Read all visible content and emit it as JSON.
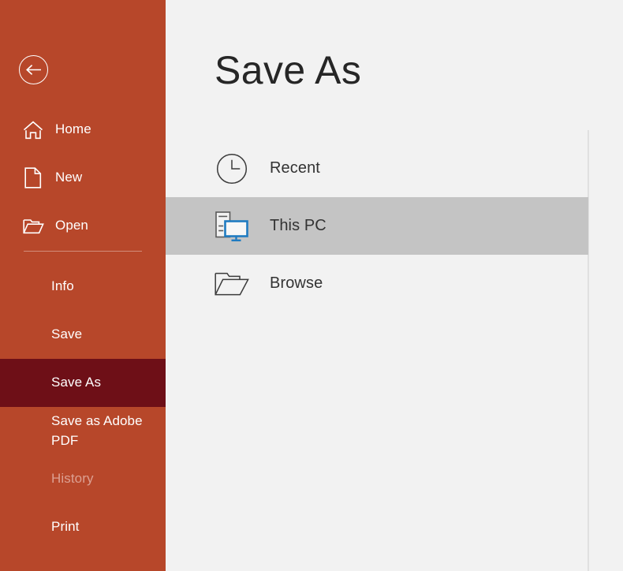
{
  "theme": {
    "sidebar_bg": "#b7472a",
    "sidebar_selected_bg": "#6e0f17",
    "main_bg": "#f2f2f2",
    "row_highlight_bg": "#c4c4c4",
    "accent_blue": "#1f7bc1",
    "text_dark": "#262626",
    "text_disabled": "#dca092"
  },
  "sidebar": {
    "back_button": {
      "name": "back-button",
      "icon": "arrow-left-circle-icon"
    },
    "top_items": [
      {
        "label": "Home",
        "icon": "home-icon",
        "state": "normal"
      },
      {
        "label": "New",
        "icon": "new-document-icon",
        "state": "normal"
      },
      {
        "label": "Open",
        "icon": "open-folder-icon",
        "state": "normal"
      }
    ],
    "bottom_items": [
      {
        "label": "Info",
        "state": "normal"
      },
      {
        "label": "Save",
        "state": "normal"
      },
      {
        "label": "Save As",
        "state": "selected"
      },
      {
        "label": "Save as Adobe PDF",
        "state": "normal"
      },
      {
        "label": "History",
        "state": "disabled"
      },
      {
        "label": "Print",
        "state": "normal"
      }
    ]
  },
  "main": {
    "title": "Save As",
    "destinations": [
      {
        "label": "Recent",
        "icon": "clock-icon",
        "selected": false
      },
      {
        "label": "This PC",
        "icon": "computer-icon",
        "selected": true
      },
      {
        "label": "Browse",
        "icon": "open-folder-icon",
        "selected": false
      }
    ]
  }
}
